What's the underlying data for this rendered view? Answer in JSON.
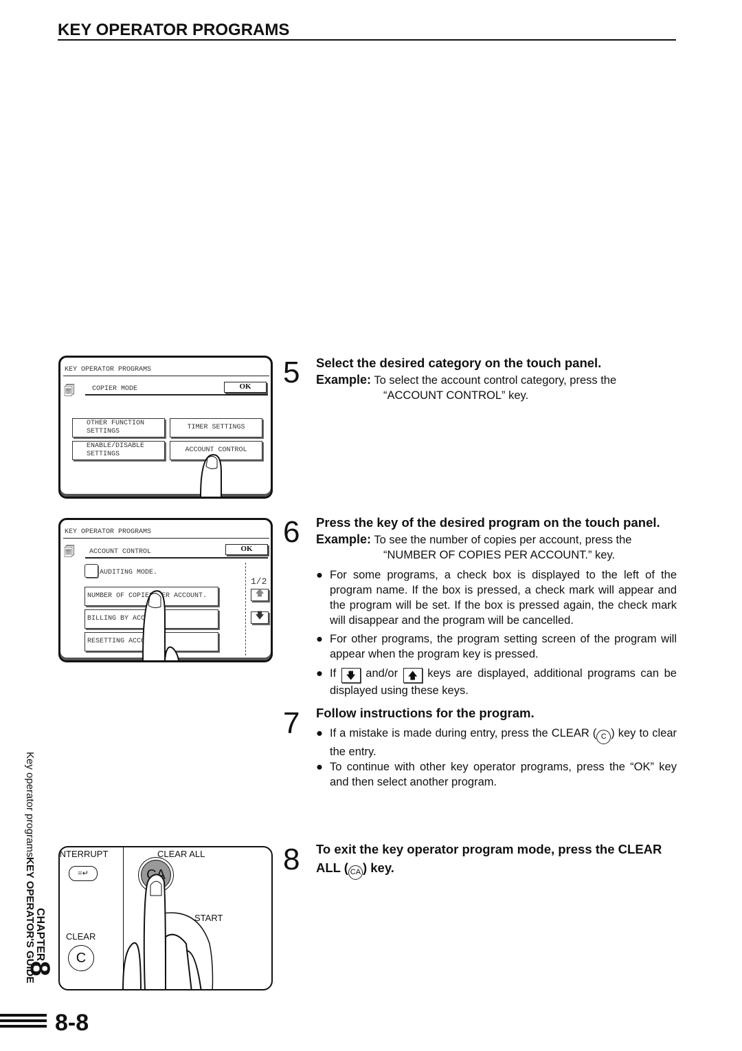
{
  "header": {
    "title": "KEY OPERATOR PROGRAMS"
  },
  "side": {
    "guide": "KEY OPERATOR'S GUIDE",
    "section": "Key operator programs",
    "chapter_label": "CHAPTER",
    "chapter_num": "8"
  },
  "footer": {
    "page_number": "8-8"
  },
  "panel1": {
    "title": "KEY OPERATOR PROGRAMS",
    "mode": "COPIER MODE",
    "ok": "OK",
    "buttons": [
      "OTHER FUNCTION SETTINGS",
      "TIMER SETTINGS",
      "ENABLE/DISABLE SETTINGS",
      "ACCOUNT CONTROL"
    ]
  },
  "panel2": {
    "title": "KEY OPERATOR PROGRAMS",
    "mode": "ACCOUNT CONTROL",
    "ok": "OK",
    "checkbox": "AUDITING MODE.",
    "page": "1/2",
    "buttons": [
      "NUMBER OF COPIES PER ACCOUNT.",
      "BILLING BY ACCOUNT.",
      "RESETTING ACCOUNT."
    ]
  },
  "panel3": {
    "interrupt": "INTERRUPT",
    "clear_all": "CLEAR ALL",
    "ca": "CA",
    "start": "START",
    "clear": "CLEAR",
    "c": "C"
  },
  "steps": [
    {
      "num": "5",
      "heading": "Select the desired category on the touch panel.",
      "example_label": "Example:",
      "example_a": "To select the account control category, press the",
      "example_b": "“ACCOUNT CONTROL” key."
    },
    {
      "num": "6",
      "heading": "Press the key of the desired program on the touch panel.",
      "example_label": "Example:",
      "example_a": "To see the number of copies per account, press the",
      "example_b": "“NUMBER OF COPIES PER ACCOUNT.” key.",
      "bullets": [
        "For some programs, a check box is displayed to the left of the program name. If the box is pressed, a check mark will appear and the program will be set. If the box is pressed again, the check mark will disappear and the program will be cancelled.",
        "For other programs, the program setting screen of the program will appear when the program key is pressed."
      ],
      "bullet3_a": "If",
      "bullet3_b": "and/or",
      "bullet3_c": "keys are displayed, additional programs can be displayed using these keys."
    },
    {
      "num": "7",
      "heading": "Follow instructions for the program.",
      "bullet1_a": "If a mistake is made during entry, press the CLEAR (",
      "bullet1_key": "C",
      "bullet1_b": ") key to clear the entry.",
      "bullet2": "To continue with other key operator programs, press the “OK” key and then select another program."
    },
    {
      "num": "8",
      "heading_a": "To exit the key operator program mode, press the CLEAR ALL (",
      "heading_key": "CA",
      "heading_b": ") key."
    }
  ]
}
